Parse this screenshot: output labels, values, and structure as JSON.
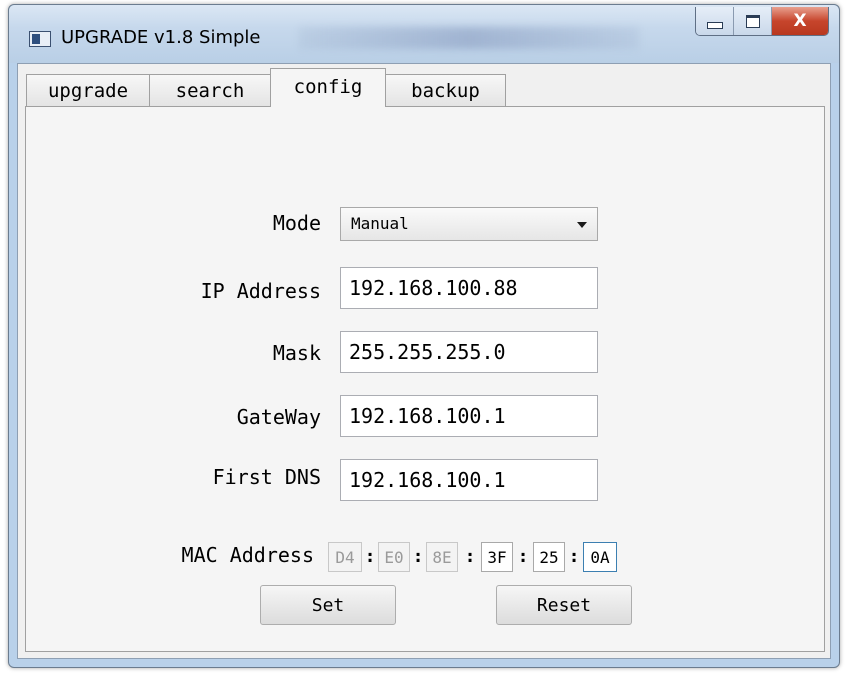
{
  "window": {
    "title": "UPGRADE v1.8 Simple",
    "close_glyph": "X"
  },
  "tabs": [
    {
      "label": "upgrade",
      "active": false
    },
    {
      "label": "search",
      "active": false
    },
    {
      "label": "config",
      "active": true
    },
    {
      "label": "backup",
      "active": false
    }
  ],
  "config": {
    "mode_label": "Mode",
    "mode_value": "Manual",
    "ip_label": "IP Address",
    "ip_value": "192.168.100.88",
    "mask_label": "Mask",
    "mask_value": "255.255.255.0",
    "gateway_label": "GateWay",
    "gateway_value": "192.168.100.1",
    "dns_label": "First DNS",
    "dns_value": "192.168.100.1",
    "mac_label": "MAC Address",
    "mac_octets": [
      "D4",
      "E0",
      "8E",
      "3F",
      "25",
      "0A"
    ],
    "mac_separator": ":",
    "set_label": "Set",
    "reset_label": "Reset"
  }
}
